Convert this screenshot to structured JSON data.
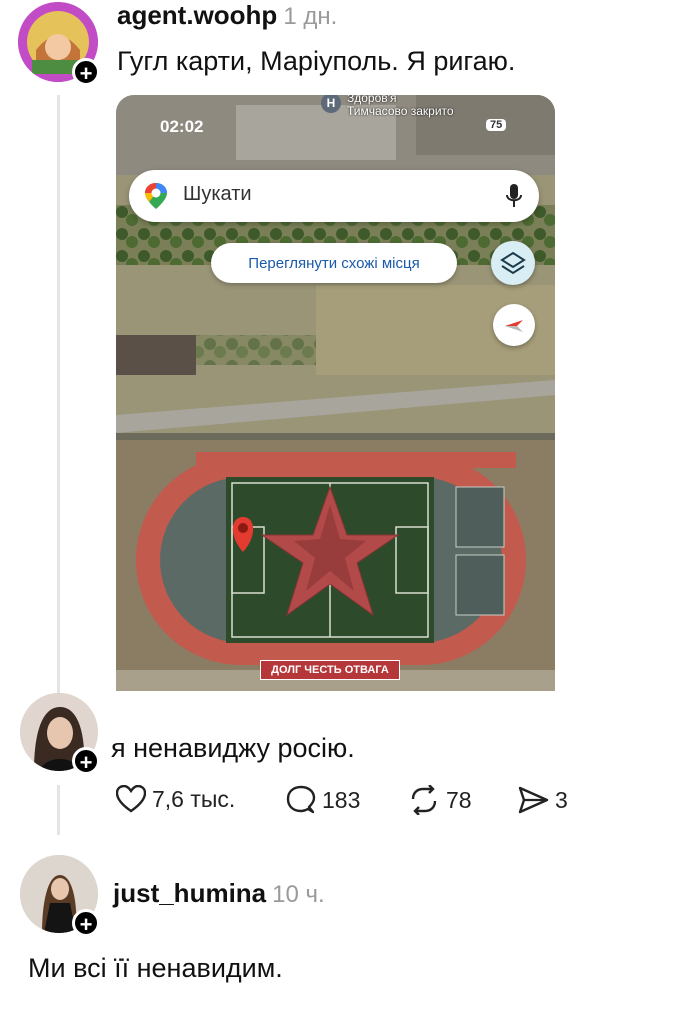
{
  "post": {
    "username": "agent.woohp",
    "time": "1 дн.",
    "text": "Гугл карти, Маріуполь. Я ригаю."
  },
  "map_screenshot": {
    "status_time": "02:02",
    "battery": "75",
    "poi_line1": "Здоров'я",
    "poi_line2": "Тимчасово закрито",
    "search_placeholder": "Шукати",
    "chip_label": "Переглянути схожі місця",
    "banner_text": "ДОЛГ ЧЕСТЬ ОТВАГА"
  },
  "reply": {
    "text": "я ненавиджу росію.",
    "likes": "7,6 тыс.",
    "comments": "183",
    "reposts": "78",
    "shares": "3"
  },
  "comment": {
    "username": "just_humina",
    "time": "10 ч.",
    "text": "Ми всі її ненавидим."
  },
  "colors": {
    "grass": "#2d4a2a",
    "track": "#c25a4e",
    "star": "#b24a4a"
  }
}
